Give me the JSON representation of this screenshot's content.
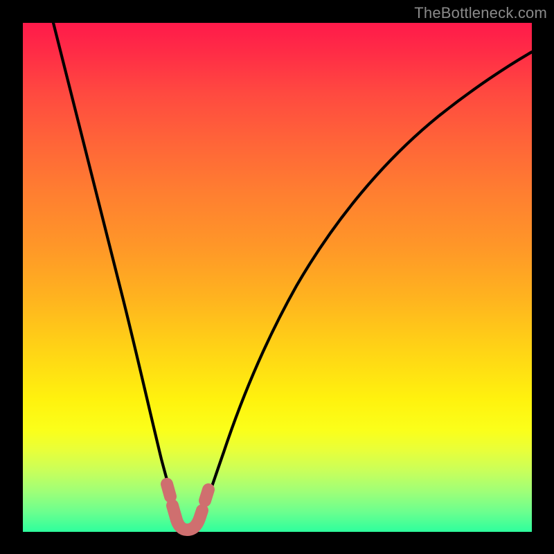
{
  "watermark": "TheBottleneck.com",
  "chart_data": {
    "type": "line",
    "title": "",
    "xlabel": "",
    "ylabel": "",
    "xlim": [
      0,
      100
    ],
    "ylim": [
      0,
      100
    ],
    "series": [
      {
        "name": "bottleneck-curve",
        "x": [
          6,
          8,
          10,
          12,
          14,
          16,
          18,
          20,
          22,
          24,
          26,
          27.5,
          29,
          30,
          31,
          32.5,
          34,
          36,
          38,
          40,
          43,
          46,
          50,
          55,
          60,
          66,
          72,
          80,
          90,
          100
        ],
        "values": [
          99,
          92,
          85,
          78,
          72,
          65,
          58,
          51,
          44,
          36,
          27,
          18,
          10,
          5,
          2,
          1.5,
          2,
          5,
          10,
          16,
          24,
          31,
          39,
          48,
          55,
          62,
          68,
          75,
          82,
          88
        ]
      },
      {
        "name": "highlight-range",
        "x": [
          27.5,
          29,
          30,
          31,
          32.5,
          34
        ],
        "values": [
          18,
          10,
          5,
          3,
          3,
          6
        ]
      }
    ],
    "colors": {
      "curve": "#000000",
      "highlight": "#cf6f6f",
      "gradient_top": "#ff1a4a",
      "gradient_bottom": "#2eff9d"
    }
  }
}
